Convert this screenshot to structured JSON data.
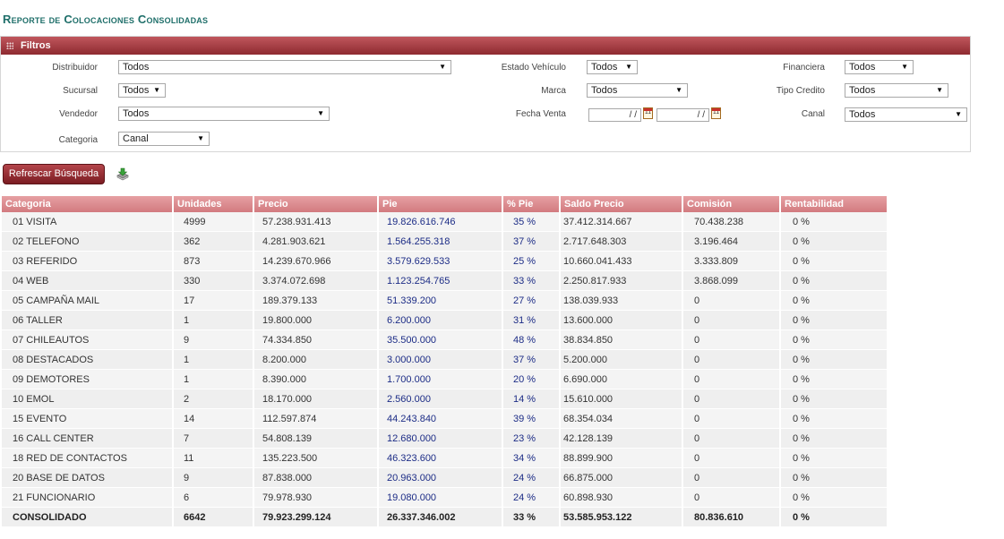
{
  "page_title": "Reporte de Colocaciones Consolidadas",
  "filters": {
    "header": "Filtros",
    "distribuidor": {
      "label": "Distribuidor",
      "value": "Todos"
    },
    "sucursal": {
      "label": "Sucursal",
      "value": "Todos"
    },
    "vendedor": {
      "label": "Vendedor",
      "value": "Todos"
    },
    "categoria": {
      "label": "Categoria",
      "value": "Canal"
    },
    "estado_vehiculo": {
      "label": "Estado Vehículo",
      "value": "Todos"
    },
    "marca": {
      "label": "Marca",
      "value": "Todos"
    },
    "fecha_venta": {
      "label": "Fecha Venta",
      "from": "/ /",
      "to": "/ /",
      "calendar_glyph": "11"
    },
    "financiera": {
      "label": "Financiera",
      "value": "Todos"
    },
    "tipo_credito": {
      "label": "Tipo Credito",
      "value": "Todos"
    },
    "canal": {
      "label": "Canal",
      "value": "Todos"
    }
  },
  "actions": {
    "refresh_label": "Refrescar Búsqueda",
    "export_icon": "export-download-icon"
  },
  "table": {
    "headers": [
      "Categoria",
      "Unidades",
      "Precio",
      "Pie",
      "% Pie",
      "Saldo Precio",
      "Comisión",
      "Rentabilidad"
    ],
    "rows": [
      [
        "01 VISITA",
        "4999",
        "57.238.931.413",
        "19.826.616.746",
        "35 %",
        "37.412.314.667",
        "70.438.238",
        "0 %"
      ],
      [
        "02 TELEFONO",
        "362",
        "4.281.903.621",
        "1.564.255.318",
        "37 %",
        "2.717.648.303",
        "3.196.464",
        "0 %"
      ],
      [
        "03 REFERIDO",
        "873",
        "14.239.670.966",
        "3.579.629.533",
        "25 %",
        "10.660.041.433",
        "3.333.809",
        "0 %"
      ],
      [
        "04 WEB",
        "330",
        "3.374.072.698",
        "1.123.254.765",
        "33 %",
        "2.250.817.933",
        "3.868.099",
        "0 %"
      ],
      [
        "05 CAMPAÑA MAIL",
        "17",
        "189.379.133",
        "51.339.200",
        "27 %",
        "138.039.933",
        "0",
        "0 %"
      ],
      [
        "06 TALLER",
        "1",
        "19.800.000",
        "6.200.000",
        "31 %",
        "13.600.000",
        "0",
        "0 %"
      ],
      [
        "07 CHILEAUTOS",
        "9",
        "74.334.850",
        "35.500.000",
        "48 %",
        "38.834.850",
        "0",
        "0 %"
      ],
      [
        "08 DESTACADOS",
        "1",
        "8.200.000",
        "3.000.000",
        "37 %",
        "5.200.000",
        "0",
        "0 %"
      ],
      [
        "09 DEMOTORES",
        "1",
        "8.390.000",
        "1.700.000",
        "20 %",
        "6.690.000",
        "0",
        "0 %"
      ],
      [
        "10 EMOL",
        "2",
        "18.170.000",
        "2.560.000",
        "14 %",
        "15.610.000",
        "0",
        "0 %"
      ],
      [
        "15 EVENTO",
        "14",
        "112.597.874",
        "44.243.840",
        "39 %",
        "68.354.034",
        "0",
        "0 %"
      ],
      [
        "16 CALL CENTER",
        "7",
        "54.808.139",
        "12.680.000",
        "23 %",
        "42.128.139",
        "0",
        "0 %"
      ],
      [
        "18 RED DE CONTACTOS",
        "11",
        "135.223.500",
        "46.323.600",
        "34 %",
        "88.899.900",
        "0",
        "0 %"
      ],
      [
        "20 BASE DE DATOS",
        "9",
        "87.838.000",
        "20.963.000",
        "24 %",
        "66.875.000",
        "0",
        "0 %"
      ],
      [
        "21 FUNCIONARIO",
        "6",
        "79.978.930",
        "19.080.000",
        "24 %",
        "60.898.930",
        "0",
        "0 %"
      ]
    ],
    "total": [
      "CONSOLIDADO",
      "6642",
      "79.923.299.124",
      "26.337.346.002",
      "33 %",
      "53.585.953.122",
      "80.836.610",
      "0 %"
    ]
  },
  "colors": {
    "title": "#1f6f6a",
    "filter_header": "#a43c42",
    "table_header": "#dc8c90",
    "pie_text": "#1c2c86"
  }
}
